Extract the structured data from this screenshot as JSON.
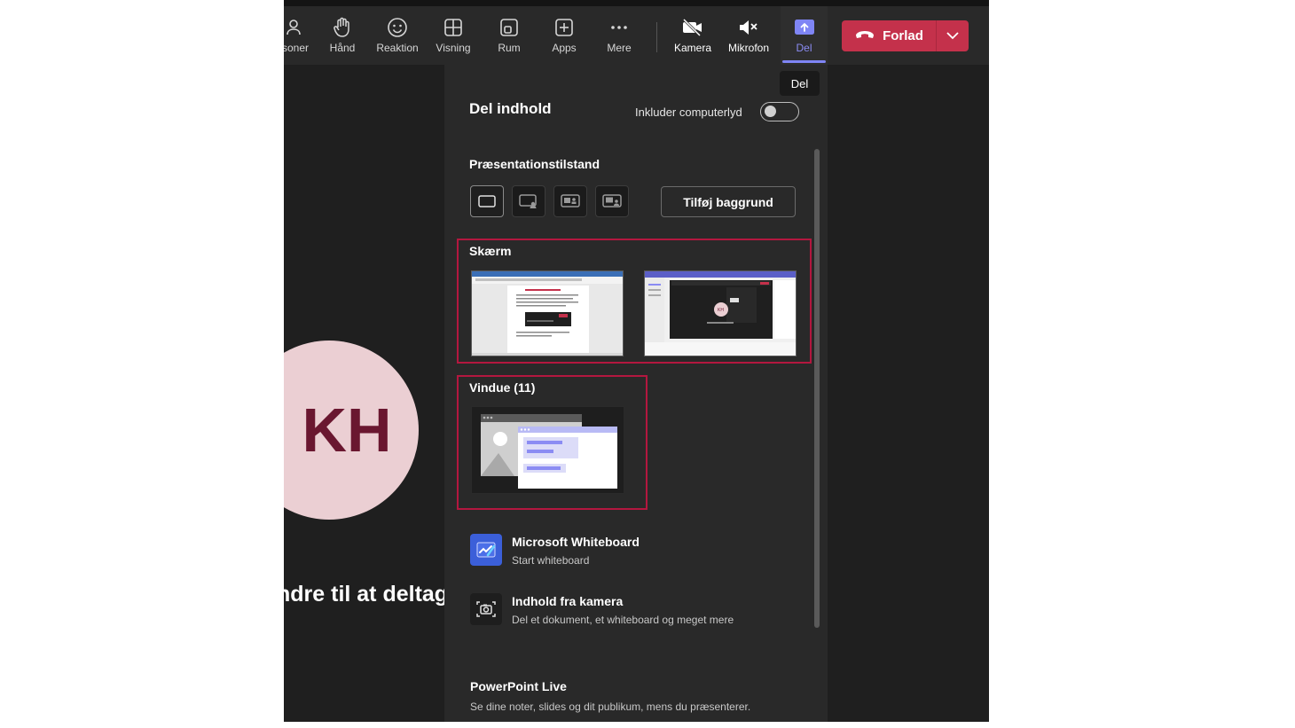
{
  "toolbar": {
    "items": [
      {
        "label": "soner",
        "icon": "people-icon"
      },
      {
        "label": "Hånd",
        "icon": "hand-icon"
      },
      {
        "label": "Reaktion",
        "icon": "smiley-icon"
      },
      {
        "label": "Visning",
        "icon": "grid-icon"
      },
      {
        "label": "Rum",
        "icon": "rooms-icon"
      },
      {
        "label": "Apps",
        "icon": "plus-square-icon"
      },
      {
        "label": "Mere",
        "icon": "more-icon"
      },
      {
        "label": "Kamera",
        "icon": "camera-off-icon"
      },
      {
        "label": "Mikrofon",
        "icon": "mic-muted-icon"
      },
      {
        "label": "Del",
        "icon": "share-icon"
      }
    ],
    "leave_label": "Forlad"
  },
  "tooltip": "Del",
  "stage": {
    "avatar_initials": "KH",
    "invite_text": "ndre til at deltag"
  },
  "panel": {
    "title": "Del indhold",
    "audio_label": "Inkluder computerlyd",
    "audio_on": false,
    "mode_title": "Præsentationstilstand",
    "add_background": "Tilføj baggrund",
    "screen_label": "Skærm",
    "window_label": "Vindue (11)",
    "options": [
      {
        "title": "Microsoft Whiteboard",
        "subtitle": "Start whiteboard",
        "icon": "whiteboard-icon"
      },
      {
        "title": "Indhold fra kamera",
        "subtitle": "Del et dokument, et whiteboard og meget mere",
        "icon": "camera-content-icon"
      },
      {
        "title": "PowerPoint Live",
        "subtitle": "Se dine noter, slides og dit publikum, mens du præsenterer."
      }
    ]
  },
  "colors": {
    "accent": "#7f85f5",
    "leave": "#c4314b",
    "highlight": "#b3173f",
    "avatar_bg": "#ebcfd3"
  }
}
